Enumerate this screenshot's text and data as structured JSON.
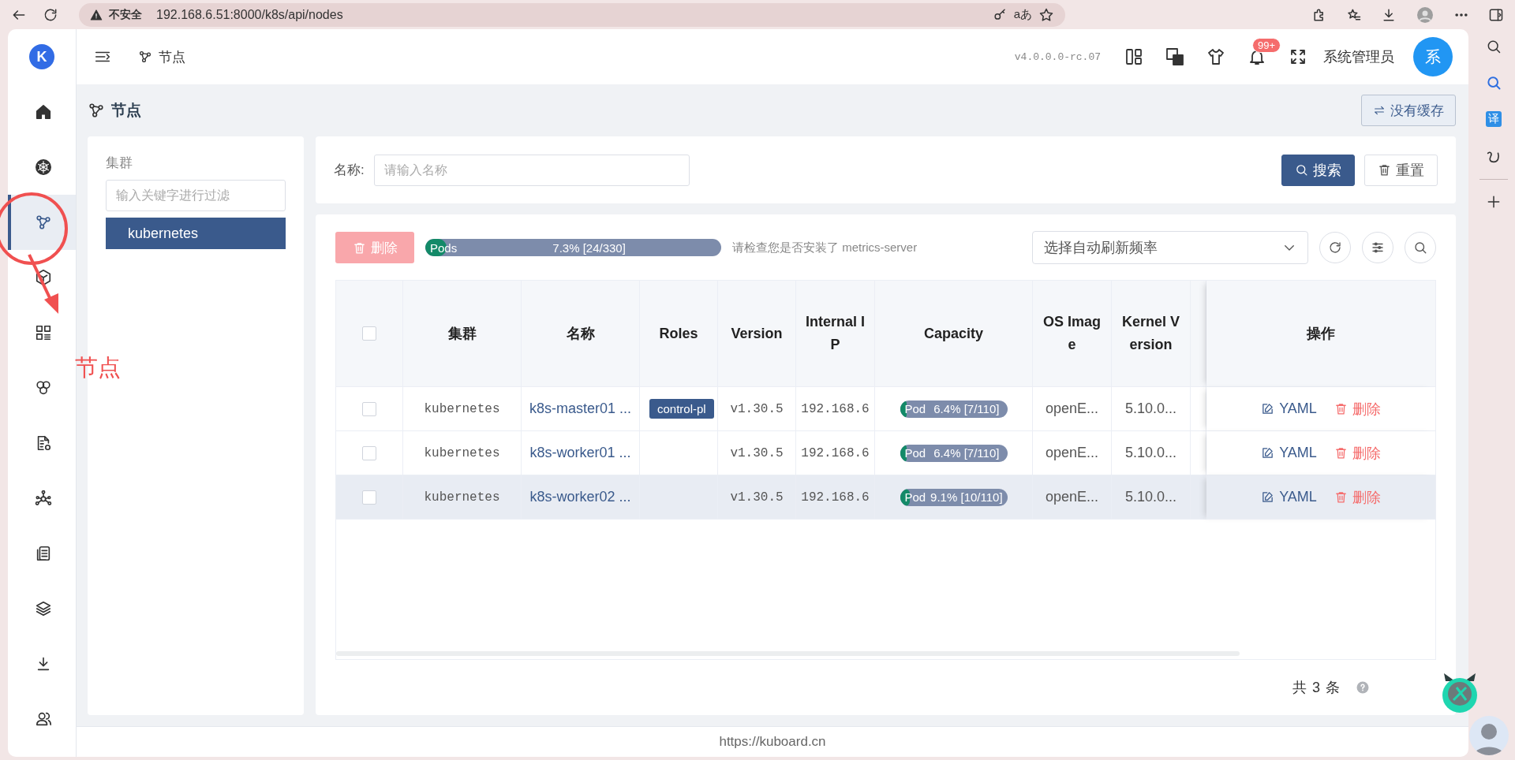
{
  "browser": {
    "security": "不安全",
    "url": "192.168.6.51:8000/k8s/api/nodes",
    "read_aloud": "aあ"
  },
  "browser_sidebar": {
    "translate": "译"
  },
  "logo": {
    "text": "K"
  },
  "nav": [
    {
      "selected": false
    },
    {
      "selected": false
    },
    {
      "selected": true
    },
    {
      "selected": false
    },
    {
      "selected": false
    },
    {
      "selected": false
    },
    {
      "selected": false
    },
    {
      "selected": false
    },
    {
      "selected": false
    },
    {
      "selected": false
    },
    {
      "selected": false
    },
    {
      "selected": false
    }
  ],
  "header": {
    "breadcrumb": "节点",
    "version": "v4.0.0.0-rc.07",
    "notification_badge": "99+",
    "user_name": "系统管理员",
    "avatar": "系"
  },
  "page": {
    "title": "节点",
    "cache_button": "没有缓存"
  },
  "cluster_panel": {
    "label": "集群",
    "filter": {
      "placeholder": "输入关键字进行过滤"
    },
    "items": [
      {
        "label": "kubernetes",
        "selected": true
      }
    ]
  },
  "search": {
    "label": "名称:",
    "name_field": {
      "placeholder": "请输入名称"
    },
    "buttons": [
      {
        "label": "搜索",
        "kind": "primary"
      },
      {
        "label": "重置",
        "kind": "default"
      }
    ]
  },
  "toolbar": {
    "delete_button": {
      "label": "删除",
      "disabled": true
    },
    "pods": {
      "label": "Pods",
      "level": 0.073,
      "reading": "7.3% [24/330]"
    },
    "hint": "请检查您是否安装了 metrics-server",
    "refresh_select": {
      "placeholder": "选择自动刷新频率"
    }
  },
  "table": {
    "select_all": {
      "checked": false
    },
    "columns": [
      "集群",
      "名称",
      "Roles",
      "Version",
      "Internal IP",
      "Capacity",
      "OS Image",
      "Kernel Version",
      "操作"
    ],
    "rows": [
      {
        "checked": false,
        "highlighted": false,
        "cluster": "kubernetes",
        "name": "k8s-master01 ...",
        "roles": [
          "control-pl"
        ],
        "version": "v1.30.5",
        "internal_ip": "192.168.6",
        "capacity": {
          "label": "Pod",
          "level": 0.064,
          "reading": "6.4% [7/110]"
        },
        "os_image": "openE...",
        "kernel_version": "5.10.0...",
        "actions": [
          "YAML",
          "删除"
        ]
      },
      {
        "checked": false,
        "highlighted": false,
        "cluster": "kubernetes",
        "name": "k8s-worker01 ...",
        "roles": [],
        "version": "v1.30.5",
        "internal_ip": "192.168.6",
        "capacity": {
          "label": "Pod",
          "level": 0.064,
          "reading": "6.4% [7/110]"
        },
        "os_image": "openE...",
        "kernel_version": "5.10.0...",
        "actions": [
          "YAML",
          "删除"
        ]
      },
      {
        "checked": false,
        "highlighted": true,
        "cluster": "kubernetes",
        "name": "k8s-worker02 ...",
        "roles": [],
        "version": "v1.30.5",
        "internal_ip": "192.168.6",
        "capacity": {
          "label": "Pod",
          "level": 0.091,
          "reading": "9.1% [10/110]"
        },
        "os_image": "openE...",
        "kernel_version": "5.10.0...",
        "actions": [
          "YAML",
          "删除"
        ]
      }
    ]
  },
  "pagination": {
    "total": "共 3 条"
  },
  "footer": {
    "url": "https://kuboard.cn"
  },
  "annotation": {
    "text": "节点"
  }
}
